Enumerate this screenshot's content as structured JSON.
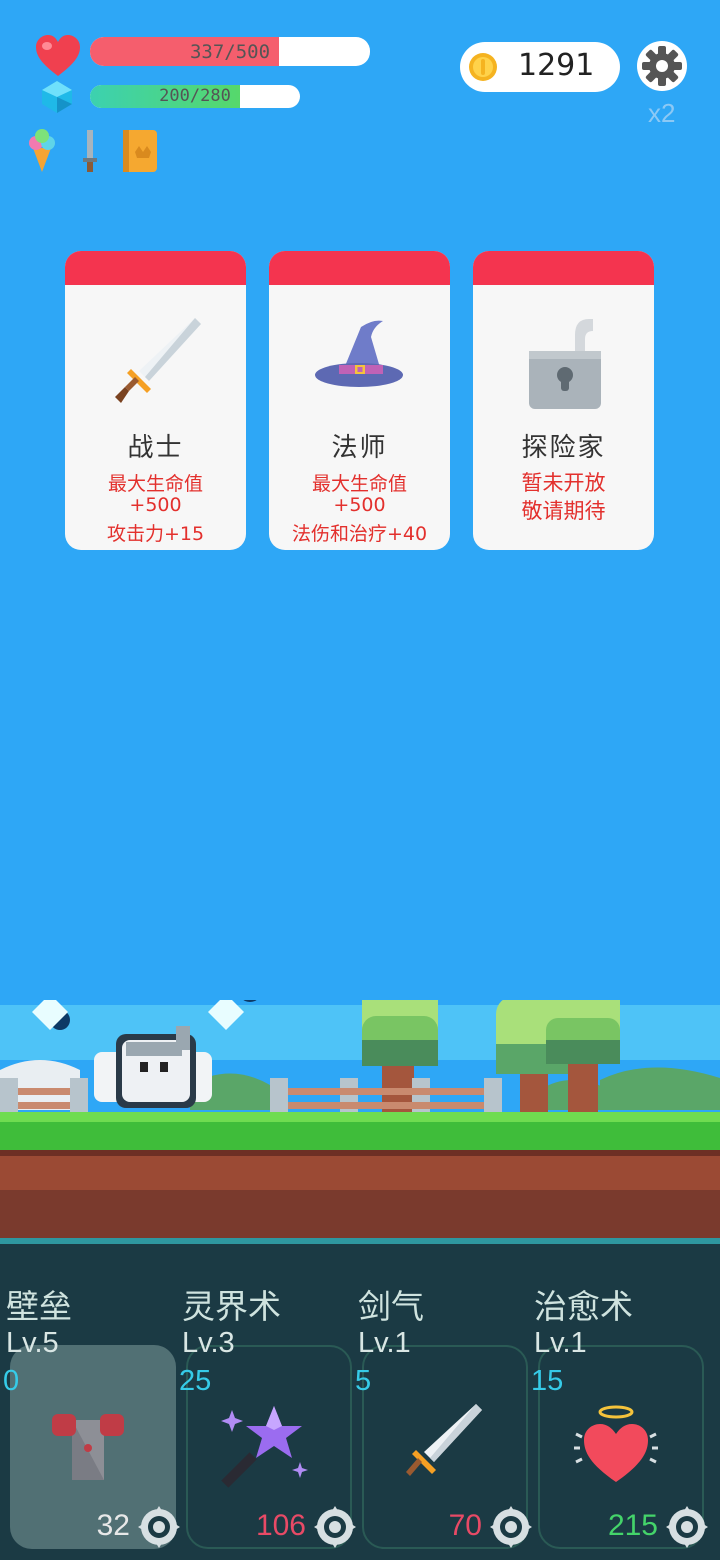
{
  "hud": {
    "hp_text": "337/500",
    "hp_fraction": 0.674,
    "mp_text": "200/280",
    "mp_fraction": 0.714,
    "coins": "1291",
    "multiplier": "x2",
    "inventory_icons": [
      "ice-cream-icon",
      "sword-icon",
      "book-icon"
    ]
  },
  "classes": [
    {
      "name": "战士",
      "icon": "sword-icon",
      "line1": "最大生命值",
      "line2": "+500",
      "line3": "攻击力+15",
      "locked": false
    },
    {
      "name": "法师",
      "icon": "wizard-hat-icon",
      "line1": "最大生命值",
      "line2": "+500",
      "line3": "法伤和治疗+40",
      "locked": false
    },
    {
      "name": "探险家",
      "icon": "padlock-icon",
      "line1": "暂未开放",
      "line2": "敬请期待",
      "locked": true
    }
  ],
  "skills": [
    {
      "name": "壁垒",
      "level": "Lv.5",
      "cost": "0",
      "value": "32",
      "value_color": "#e8e8e8",
      "icon": "armor-icon",
      "active": true
    },
    {
      "name": "灵界术",
      "level": "Lv.3",
      "cost": "25",
      "value": "106",
      "value_color": "#e84a66",
      "icon": "magic-wand-icon",
      "active": false
    },
    {
      "name": "剑气",
      "level": "Lv.1",
      "cost": "5",
      "value": "70",
      "value_color": "#e84a66",
      "icon": "sword-icon",
      "active": false
    },
    {
      "name": "治愈术",
      "level": "Lv.1",
      "cost": "15",
      "value": "215",
      "value_color": "#44d46a",
      "icon": "holy-heart-icon",
      "active": false
    }
  ],
  "colors": {
    "sky": "#2ea7f6",
    "card_header": "#f4344f",
    "hp": "#f55e6d",
    "mana": "#3cd1b0",
    "panel": "#1b3a44"
  }
}
